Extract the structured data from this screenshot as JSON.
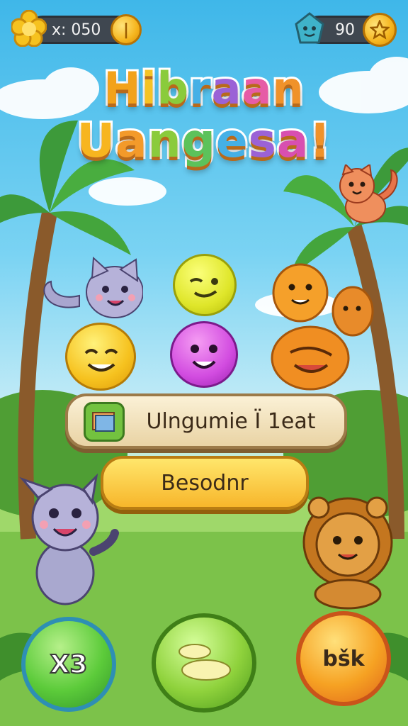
{
  "hud": {
    "left_label": "x: 050",
    "right_value": "90"
  },
  "title": {
    "line1": [
      "H",
      "i",
      "b",
      "r",
      "a",
      "a",
      "n"
    ],
    "line2": [
      "U",
      "a",
      "n",
      "g",
      "e",
      "s",
      "a",
      "!"
    ],
    "line1_colors": [
      "#f2a21a",
      "#f6c324",
      "#8acb3c",
      "#45b0e6",
      "#9b62d6",
      "#e65ca6",
      "#f0922a"
    ],
    "line2_colors": [
      "#f7b51f",
      "#f39a2a",
      "#8acb3c",
      "#5cc25b",
      "#45b0e6",
      "#9b62d6",
      "#d84fb0",
      "#f0922a"
    ]
  },
  "buttons": {
    "language_label": "Ulngumie Ï 1eat",
    "primary_label": "Besodnr",
    "x3_label": "X3",
    "bsk_label": "bšk"
  },
  "colors": {
    "sky": "#3fb7e9",
    "grass": "#6db842",
    "hud_pill": "#3f4750",
    "coin": "#f5b51e"
  },
  "icons": [
    "flower-icon",
    "coin-icon",
    "gem-icon",
    "star-icon",
    "book-icon",
    "speech-bubble-icon"
  ]
}
